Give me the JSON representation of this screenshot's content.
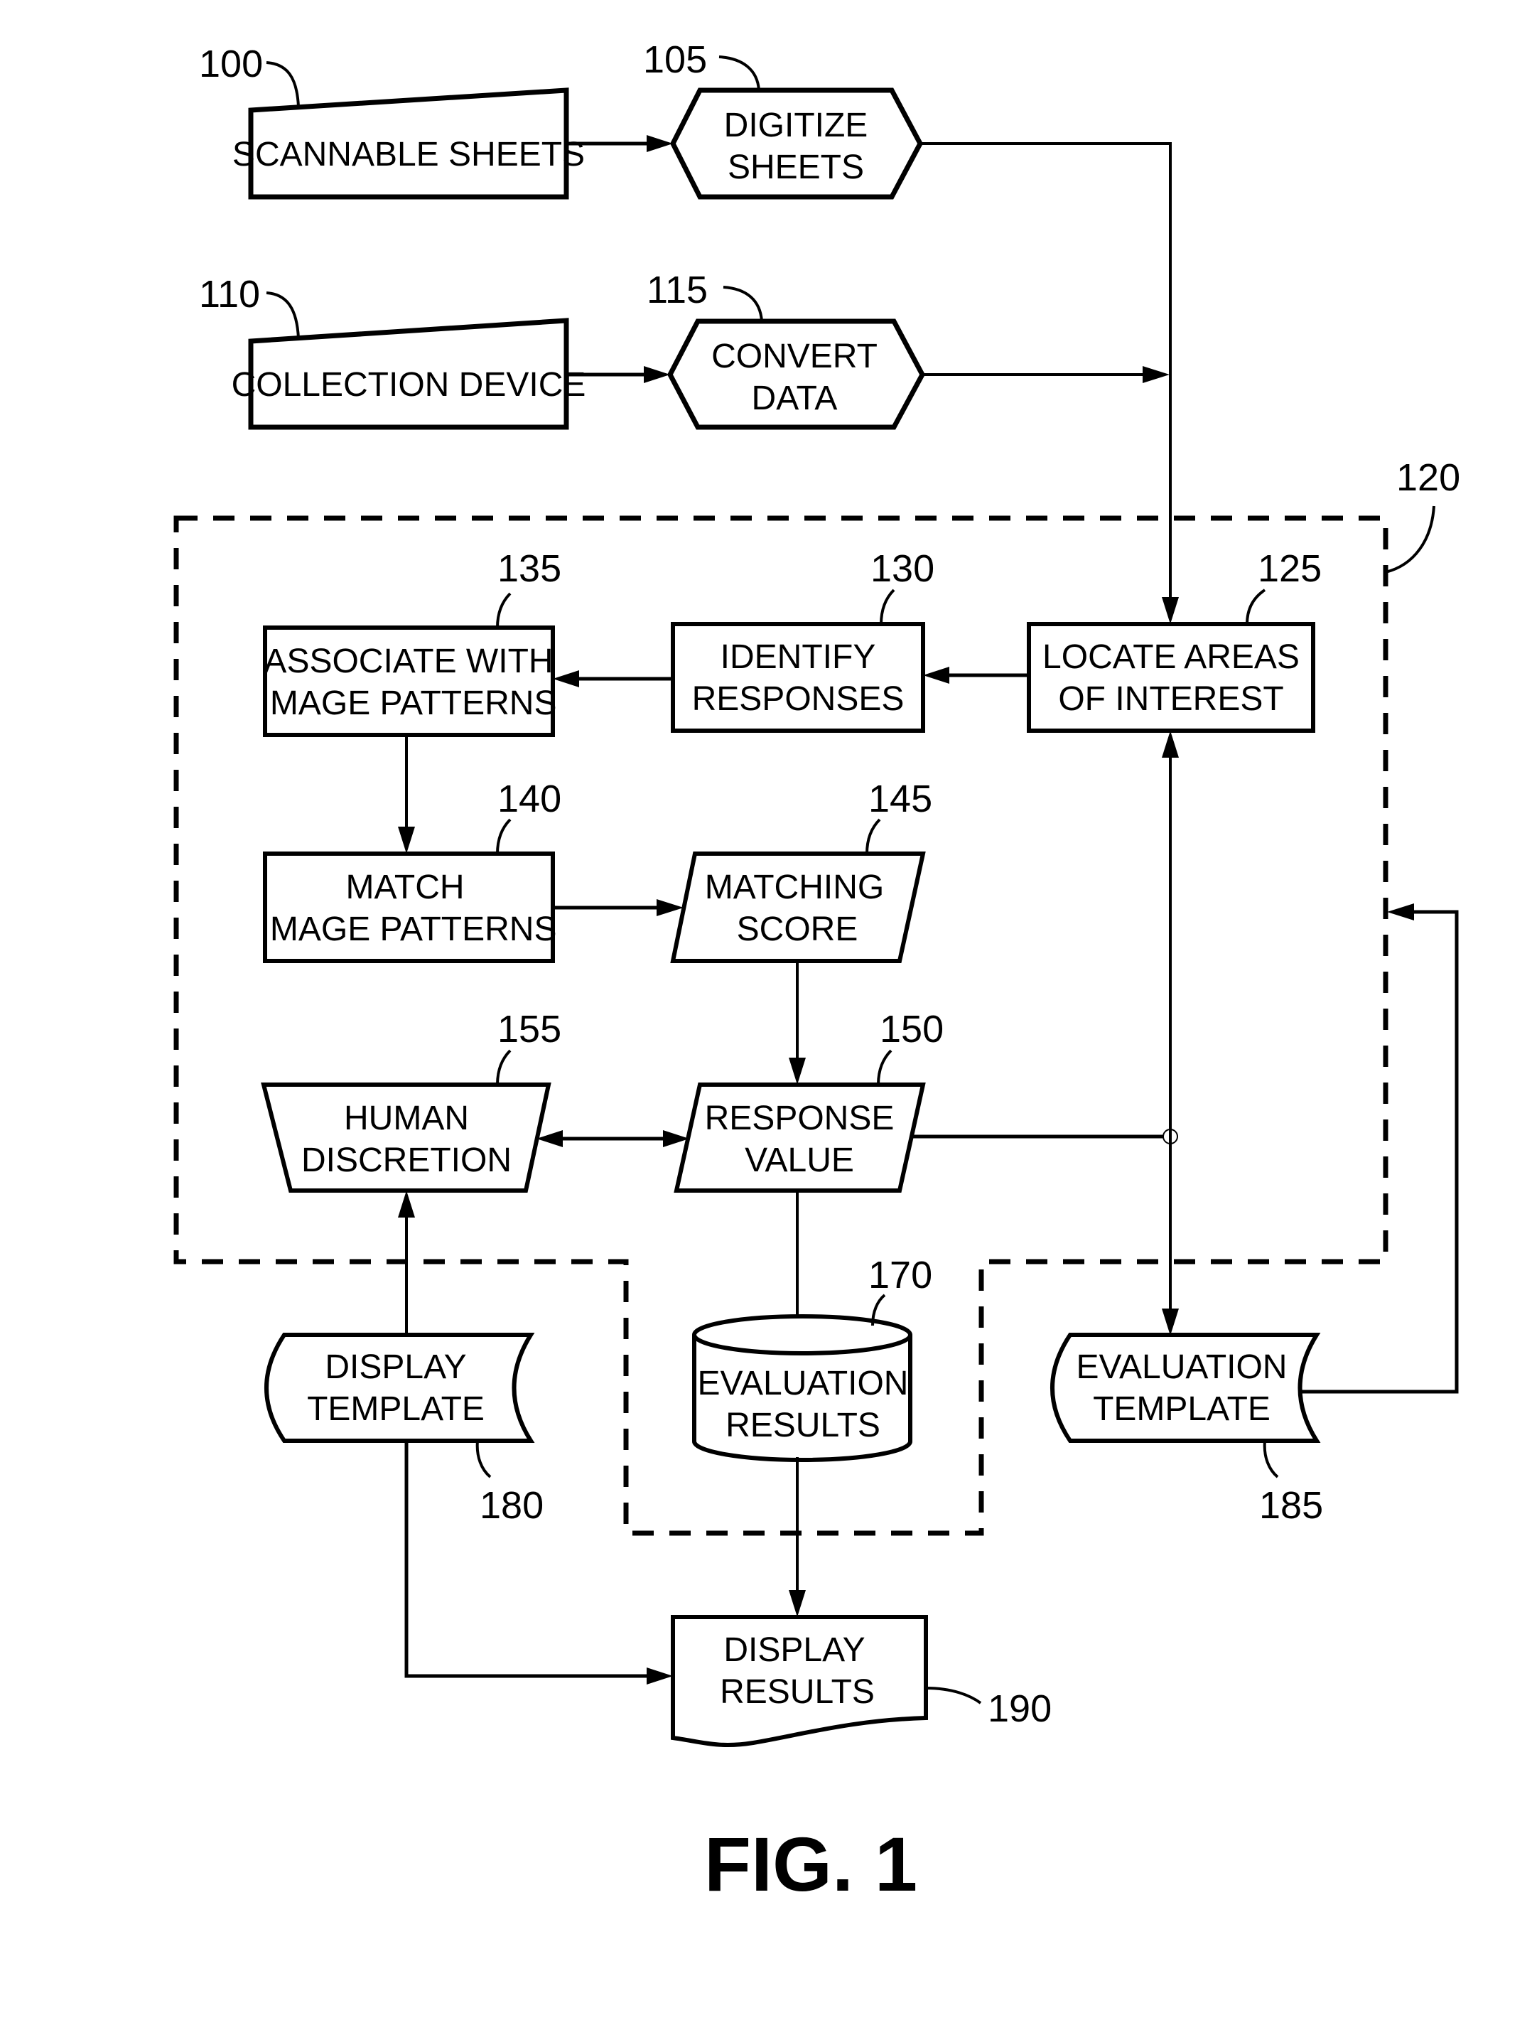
{
  "figure": {
    "caption": "FIG. 1",
    "colors": {
      "line": "#000000",
      "background": "#ffffff"
    }
  },
  "nodes": {
    "scannable_sheets": {
      "ref": "100",
      "lines": [
        "SCANNABLE SHEETS"
      ],
      "shape": "manual-input"
    },
    "digitize_sheets": {
      "ref": "105",
      "lines": [
        "DIGITIZE",
        "SHEETS"
      ],
      "shape": "preparation-hexagon"
    },
    "collection_device": {
      "ref": "110",
      "lines": [
        "COLLECTION DEVICE"
      ],
      "shape": "manual-input"
    },
    "convert_data": {
      "ref": "115",
      "lines": [
        "CONVERT",
        "DATA"
      ],
      "shape": "preparation-hexagon"
    },
    "processing_system": {
      "ref": "120",
      "shape": "dashed-boundary"
    },
    "locate_areas": {
      "ref": "125",
      "lines": [
        "LOCATE AREAS",
        "OF INTEREST"
      ],
      "shape": "process"
    },
    "identify_responses": {
      "ref": "130",
      "lines": [
        "IDENTIFY",
        "RESPONSES"
      ],
      "shape": "process"
    },
    "associate_patterns": {
      "ref": "135",
      "lines": [
        "ASSOCIATE WITH",
        "IMAGE PATTERNS"
      ],
      "shape": "process"
    },
    "match_patterns": {
      "ref": "140",
      "lines": [
        "MATCH",
        "IMAGE PATTERNS"
      ],
      "shape": "process"
    },
    "matching_score": {
      "ref": "145",
      "lines": [
        "MATCHING",
        "SCORE"
      ],
      "shape": "data-parallelogram"
    },
    "response_value": {
      "ref": "150",
      "lines": [
        "RESPONSE",
        "VALUE"
      ],
      "shape": "data-parallelogram"
    },
    "human_discretion": {
      "ref": "155",
      "lines": [
        "HUMAN",
        "DISCRETION"
      ],
      "shape": "manual-operation"
    },
    "evaluation_results": {
      "ref": "170",
      "lines": [
        "EVALUATION",
        "RESULTS"
      ],
      "shape": "database-cylinder"
    },
    "display_template": {
      "ref": "180",
      "lines": [
        "DISPLAY",
        "TEMPLATE"
      ],
      "shape": "stored-data"
    },
    "evaluation_template": {
      "ref": "185",
      "lines": [
        "EVALUATION",
        "TEMPLATE"
      ],
      "shape": "stored-data"
    },
    "display_results": {
      "ref": "190",
      "lines": [
        "DISPLAY",
        "RESULTS"
      ],
      "shape": "document"
    }
  },
  "edges": [
    {
      "from": "scannable_sheets",
      "to": "digitize_sheets",
      "arrow": "end"
    },
    {
      "from": "collection_device",
      "to": "convert_data",
      "arrow": "end"
    },
    {
      "from": "digitize_sheets",
      "to": "locate_areas",
      "arrow": "end"
    },
    {
      "from": "convert_data",
      "to": "locate_areas",
      "arrow": "end"
    },
    {
      "from": "locate_areas",
      "to": "identify_responses",
      "arrow": "end"
    },
    {
      "from": "identify_responses",
      "to": "associate_patterns",
      "arrow": "end"
    },
    {
      "from": "associate_patterns",
      "to": "match_patterns",
      "arrow": "end"
    },
    {
      "from": "match_patterns",
      "to": "matching_score",
      "arrow": "end"
    },
    {
      "from": "matching_score",
      "to": "response_value",
      "arrow": "end"
    },
    {
      "from": "human_discretion",
      "to": "response_value",
      "arrow": "both"
    },
    {
      "from": "response_value",
      "to": "evaluation_results",
      "arrow": "end"
    },
    {
      "from": "response_value",
      "to": "evaluation_template",
      "arrow": "none",
      "note": "joins vertical line at junction"
    },
    {
      "from": "evaluation_template",
      "to": "locate_areas",
      "arrow": "both"
    },
    {
      "from": "evaluation_template",
      "to": "processing_system",
      "arrow": "end"
    },
    {
      "from": "display_template",
      "to": "human_discretion",
      "arrow": "end"
    },
    {
      "from": "display_template",
      "to": "display_results",
      "arrow": "end"
    },
    {
      "from": "evaluation_results",
      "to": "display_results",
      "arrow": "end"
    }
  ]
}
